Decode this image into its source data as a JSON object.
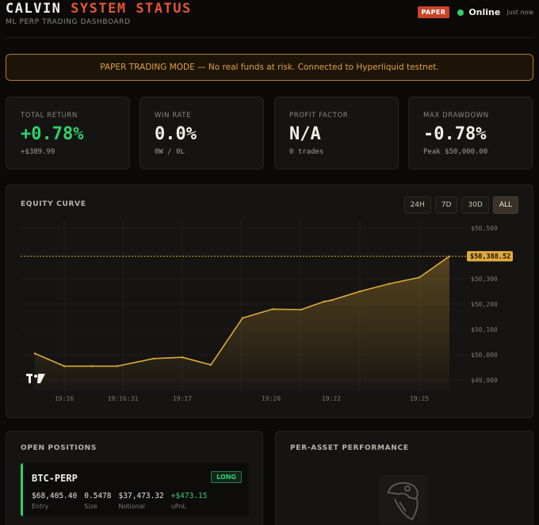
{
  "header": {
    "title_part1": "CALVIN",
    "title_part2": "SYSTEM STATUS",
    "subtitle": "ML PERP TRADING DASHBOARD",
    "mode_badge": "PAPER",
    "status": "Online",
    "last_update": "just now",
    "status_color": "#2fd26b",
    "accent_color": "#e4572e"
  },
  "banner": {
    "text": "PAPER TRADING MODE — No real funds at risk. Connected to Hyperliquid testnet."
  },
  "stats": [
    {
      "label": "TOTAL RETURN",
      "value": "+0.78%",
      "sub": "+$389.99"
    },
    {
      "label": "WIN RATE",
      "value": "0.0%",
      "sub": "0W / 0L"
    },
    {
      "label": "PROFIT FACTOR",
      "value": "N/A",
      "sub": "0 trades"
    },
    {
      "label": "MAX DRAWDOWN",
      "value": "-0.78%",
      "sub": "Peak $50,000.00"
    }
  ],
  "equity": {
    "title": "EQUITY CURVE",
    "timeframes": [
      "24H",
      "7D",
      "30D",
      "ALL"
    ],
    "active_timeframe": "ALL",
    "watermark_icon": "tradingview-logo-icon"
  },
  "chart_data": {
    "type": "area",
    "x": [
      "19:15:45",
      "19:16",
      "19:16:31",
      "19:16:45",
      "19:17",
      "19:17:30",
      "19:18:10",
      "19:19:40",
      "19:20",
      "19:21",
      "19:21:50",
      "19:22",
      "19:23",
      "19:24",
      "19:25",
      "19:25:40"
    ],
    "values": [
      50005,
      49955,
      49955,
      49955,
      49985,
      49990,
      49960,
      50145,
      50180,
      50178,
      50210,
      50215,
      50250,
      50280,
      50305,
      50388.52
    ],
    "x_tick_labels": [
      "19:16",
      "19:16:31",
      "19:17",
      "19:20",
      "19:22",
      "19:25"
    ],
    "y_tick_labels": [
      "$50,500",
      "$50,400",
      "$50,300",
      "$50,200",
      "$50,100",
      "$50,000",
      "$49,900"
    ],
    "ylim": [
      49900,
      50500
    ],
    "last_value_label": "$50,388.52",
    "line_color": "#e0a93a",
    "grid": true
  },
  "positions": {
    "title": "OPEN POSITIONS",
    "items": [
      {
        "symbol": "BTC-PERP",
        "side": "LONG",
        "entry": "$68,405.40",
        "entry_label": "Entry",
        "size": "0.5478",
        "size_label": "Size",
        "notional": "$37,473.32",
        "notional_label": "Notional",
        "upnl": "+$473.15",
        "upnl_label": "uPnL"
      }
    ]
  },
  "performance": {
    "title": "PER-ASSET PERFORMANCE",
    "placeholder_icon": "parrot-mascot-icon"
  }
}
